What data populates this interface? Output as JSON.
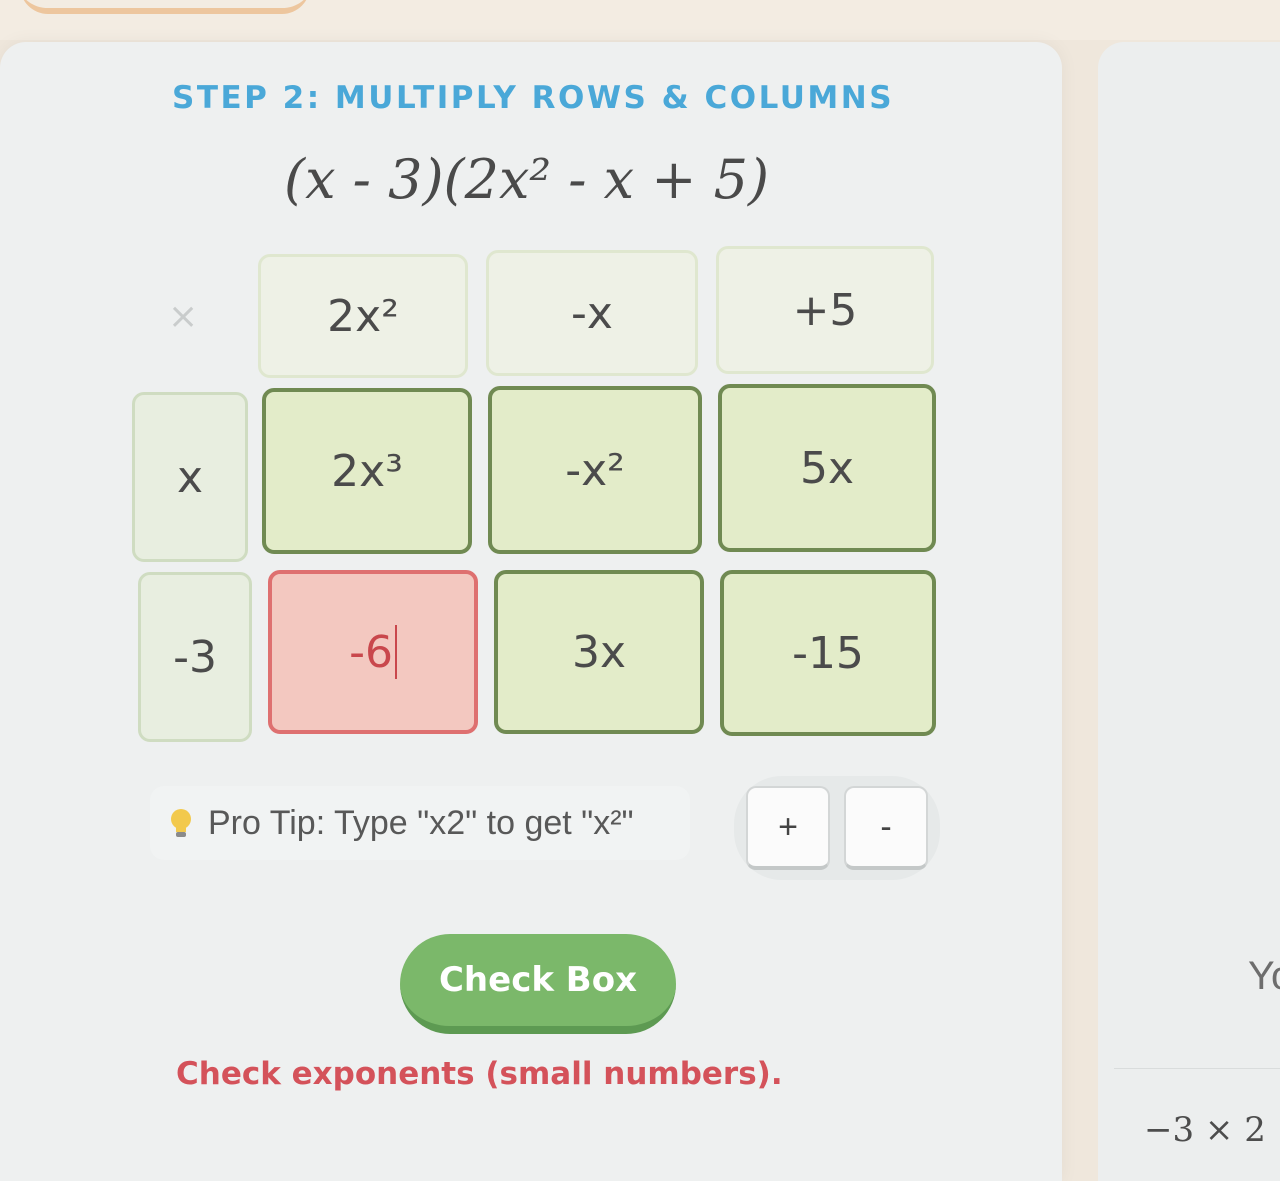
{
  "step": {
    "title": "STEP 2: MULTIPLY ROWS & COLUMNS",
    "expression": "(x - 3)(2x² - x + 5)"
  },
  "grid": {
    "corner_symbol": "×",
    "column_headers": [
      "2x²",
      "-x",
      "+5"
    ],
    "row_headers": [
      "x",
      "-3"
    ],
    "cells": [
      [
        "2x³",
        "-x²",
        "5x"
      ],
      [
        "-6",
        "3x",
        "-15"
      ]
    ],
    "active_cell_state": "error"
  },
  "tip": {
    "icon": "lightbulb-icon",
    "text": "Pro Tip: Type \"x2\" to get \"x²\""
  },
  "sign_buttons": {
    "plus": "+",
    "minus": "-"
  },
  "check_button": {
    "label": "Check Box"
  },
  "feedback": {
    "message": "Check exponents (small numbers)."
  },
  "side_panel": {
    "partial_text": "Yo",
    "expression": "−3 × 2"
  },
  "colors": {
    "title_blue": "#4aa8d8",
    "cell_green": "#e3ecc9",
    "cell_border_green": "#708a52",
    "error_red": "#de7070",
    "button_green": "#7bb86a",
    "feedback_red": "#d4525a"
  }
}
